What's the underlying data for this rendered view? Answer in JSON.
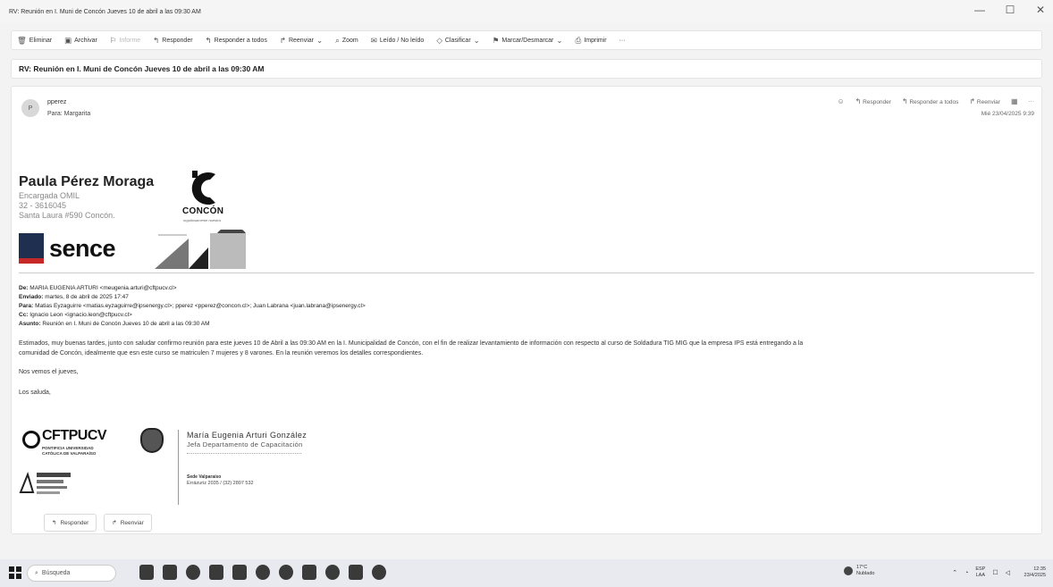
{
  "window": {
    "title": "RV: Reunión en I. Muni de Concón Jueves 10 de abril a las 09:30 AM",
    "minimize": "—",
    "maximize": "☐",
    "close": "✕"
  },
  "toolbar": {
    "items": [
      {
        "label": "Eliminar",
        "icon": "trash-icon"
      },
      {
        "label": "Archivar",
        "icon": "archive-icon"
      },
      {
        "label": "Informe",
        "icon": "report-icon"
      },
      {
        "label": "Responder",
        "icon": "reply-icon"
      },
      {
        "label": "Responder a todos",
        "icon": "reply-all-icon"
      },
      {
        "label": "Reenviar",
        "icon": "forward-icon"
      },
      {
        "label": "Zoom",
        "icon": "zoom-icon"
      },
      {
        "label": "Leído / No leído",
        "icon": "read-unread-icon"
      },
      {
        "label": "Clasificar",
        "icon": "tag-icon"
      },
      {
        "label": "Marcar/Desmarcar",
        "icon": "flag-icon"
      },
      {
        "label": "Imprimir",
        "icon": "print-icon"
      },
      {
        "label": "···",
        "icon": "more-icon"
      }
    ]
  },
  "subject": "RV: Reunión en I. Muni de Concón Jueves 10 de abril a las 09:30 AM",
  "message": {
    "avatar_initial": "P",
    "sender": "pperez",
    "to": "Para:  Margarita",
    "actions": {
      "reply": "Responder",
      "reply_all": "Responder a todos",
      "forward": "Reenviar",
      "more": "···"
    },
    "date": "Mié 23/04/2025 9:39"
  },
  "signature": {
    "name": "Paula Pérez Moraga",
    "role": "Encargada OMIL",
    "phone": "32 - 3616045",
    "address": "Santa Laura #590 Concón.",
    "concon_logo_text": "CONCÓN",
    "concon_tagline": "orgullosamente nuestra",
    "sence_logo_text": "sence"
  },
  "forwarded_header": {
    "from_label": "De:",
    "from": "MARIA EUGENIA ARTURI <meugenia.arturi@cftpucv.cl>",
    "sent_label": "Enviado:",
    "sent": "martes, 8 de abril de 2025 17:47",
    "to_label": "Para:",
    "to": "Matias Eyzaguirre <matias.eyzaguirre@ipsenergy.cl>; pperez <pperez@concon.cl>; Juan Labrana <juan.labrana@ipsenergy.cl>",
    "cc_label": "Cc:",
    "cc": "Ignacio Leon <ignacio.leon@cftpucv.cl>",
    "subject_label": "Asunto:",
    "subject": "Reunión en I. Muni de Concón Jueves 10 de abril a las 09:30 AM"
  },
  "body": {
    "line1": "Estimados, muy buenas tardes, junto con saludar confirmo reunión para este jueves 10 de Abril a las 09:30 AM en la I. Municipalidad de Concón, con el fin de realizar levantamiento de información con respecto al curso de Soldadura TIG MIG que la empresa IPS está entregando a la",
    "line2": "comunidad de Concón, idealmente que esn este curso se matriculen 7 mujeres y 8 varones. En la reunión veremos los detalles correspondientes.",
    "closing1": "Nos vemos el jueves,",
    "closing2": "Los saluda,"
  },
  "signature2": {
    "org_logo_text": "CFTPUCV",
    "org_sub1": "PONTIFICIA UNIVERSIDAD",
    "org_sub2": "CATÓLICA DE VALPARAÍSO",
    "name": "María Eugenia Arturi González",
    "role": "Jefa Departamento de Capacitación",
    "sede": "Sede Valparaíso",
    "sede_address": "Errázuriz 2035 / (32) 2807 532"
  },
  "reply_buttons": {
    "reply": "Responder",
    "forward": "Reenviar"
  },
  "taskbar": {
    "search_placeholder": "Búsqueda",
    "weather_temp": "17°C",
    "weather_desc": "Nublado",
    "lang_top": "ESP",
    "lang_bottom": "LAA",
    "time": "12:35",
    "date": "23/4/2025"
  },
  "colors": {
    "sence_flag_blue": "#1f2f4f",
    "sence_flag_red": "#c62828"
  }
}
